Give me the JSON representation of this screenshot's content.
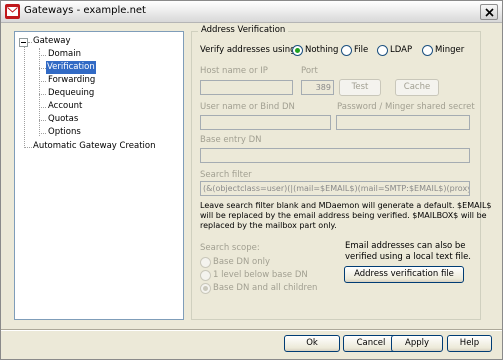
{
  "window": {
    "title": "Gateways - example.net"
  },
  "tree": {
    "root": "Gateway",
    "children": [
      "Domain",
      "Verification",
      "Forwarding",
      "Dequeuing",
      "Account",
      "Quotas",
      "Options"
    ],
    "selected": "Verification",
    "other": "Automatic Gateway Creation"
  },
  "panel": {
    "section_title": "Address Verification",
    "verify_label": "Verify addresses using:",
    "verify_options": [
      "Nothing",
      "File",
      "LDAP",
      "Minger"
    ],
    "verify_selected": "Nothing",
    "host_label": "Host name or IP",
    "host_value": "",
    "port_label": "Port",
    "port_value": "389",
    "test_button": "Test",
    "cache_button": "Cache",
    "user_label": "User name or Bind DN",
    "user_value": "",
    "password_label": "Password / Minger shared secret",
    "password_value": "",
    "base_dn_label": "Base entry DN",
    "base_dn_value": "",
    "search_filter_label": "Search filter",
    "search_filter_value": "(&(objectclass=user)(|(mail=$EMAIL$)(mail=SMTP:$EMAIL$)(proxyAddresses",
    "help_text_1": "Leave search filter blank and MDaemon will generate a default.  $EMAIL$",
    "help_text_2": "will be replaced by the email address being verified.  $MAILBOX$ will be",
    "help_text_3": "replaced by the mailbox part only.",
    "scope_label": "Search scope:",
    "scope_options": [
      "Base DN only",
      "1 level below base DN",
      "Base DN and all children"
    ],
    "scope_selected": "Base DN and all children",
    "local_file_text_1": "Email addresses can also be",
    "local_file_text_2": "verified using a local text file.",
    "address_file_button": "Address verification file"
  },
  "footer": {
    "ok": "Ok",
    "cancel": "Cancel",
    "apply": "Apply",
    "help": "Help"
  },
  "colors": {
    "selection": "#316ac5",
    "radio_dot": "#21a121",
    "app_icon": "#c0181c"
  }
}
